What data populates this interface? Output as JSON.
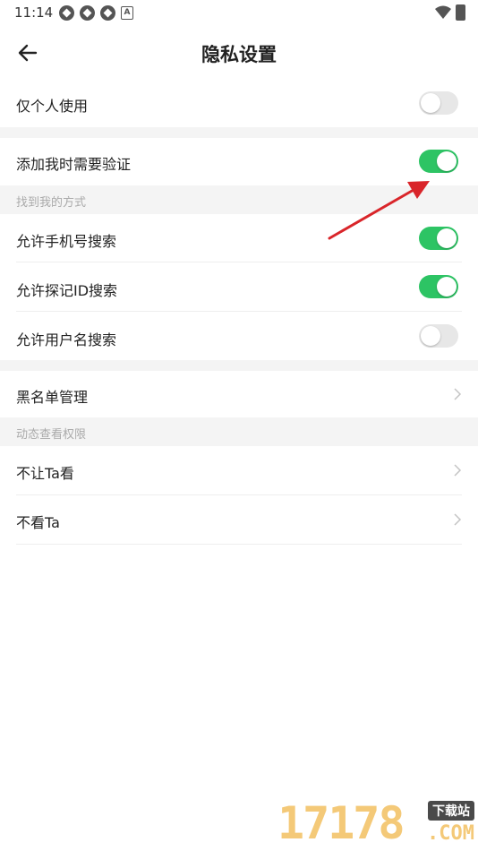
{
  "status_bar": {
    "time": "11:14"
  },
  "header": {
    "title": "隐私设置"
  },
  "rows": {
    "only_personal": {
      "label": "仅个人使用",
      "enabled": false
    },
    "require_verify": {
      "label": "添加我时需要验证",
      "enabled": true
    },
    "phone_search": {
      "label": "允许手机号搜索",
      "enabled": true
    },
    "id_search": {
      "label": "允许探记ID搜索",
      "enabled": true
    },
    "username_search": {
      "label": "允许用户名搜索",
      "enabled": false
    },
    "blacklist": {
      "label": "黑名单管理"
    },
    "hide_from": {
      "label": "不让Ta看"
    },
    "not_see": {
      "label": "不看Ta"
    }
  },
  "sections": {
    "find_me": "找到我的方式",
    "moments": "动态查看权限"
  },
  "colors": {
    "toggle_on": "#2dc464",
    "toggle_off": "#e7e7e7",
    "annotation_arrow": "#d9252a"
  },
  "watermark": {
    "digits": "17178",
    "badge": "下载站",
    "suffix": ".COM"
  }
}
